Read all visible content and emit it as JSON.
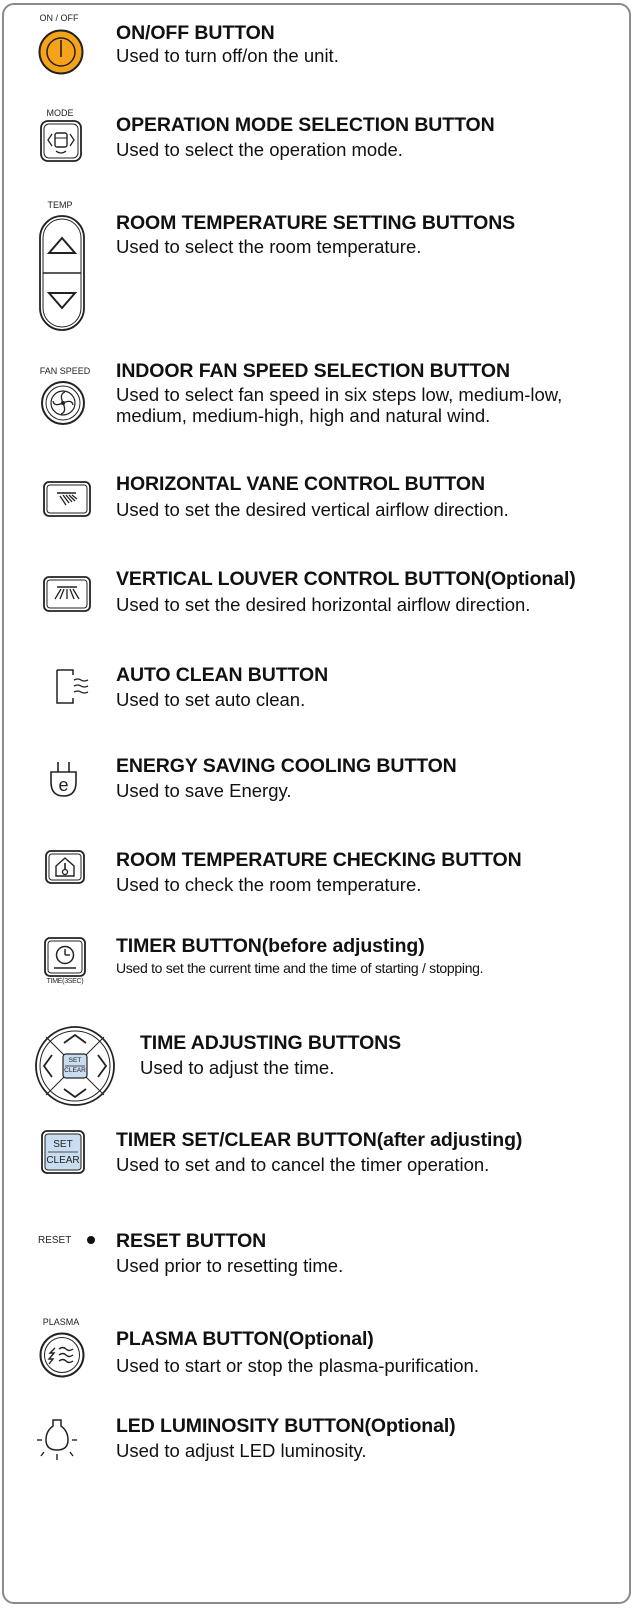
{
  "items": [
    {
      "label": "ON / OFF",
      "title": "ON/OFF BUTTON",
      "desc": "Used to turn off/on the unit.",
      "icon": "power-icon"
    },
    {
      "label": "MODE",
      "title": "OPERATION MODE SELECTION BUTTON",
      "desc": "Used to select the operation mode.",
      "icon": "mode-icon"
    },
    {
      "label": "TEMP",
      "title": "ROOM TEMPERATURE SETTING BUTTONS",
      "desc": "Used to select the room temperature.",
      "icon": "temp-up-down-icon"
    },
    {
      "label": "FAN SPEED",
      "title": "INDOOR FAN SPEED SELECTION BUTTON",
      "desc": "Used to select fan speed in six steps low, medium-low,",
      "desc2": "medium, medium-high, high and natural wind.",
      "icon": "fan-icon"
    },
    {
      "title": "HORIZONTAL VANE CONTROL BUTTON",
      "desc": "Used to set the desired vertical airflow direction.",
      "icon": "vane-icon"
    },
    {
      "title": "VERTICAL LOUVER CONTROL BUTTON(Optional)",
      "desc": "Used to set the desired horizontal airflow direction.",
      "icon": "louver-icon"
    },
    {
      "title": "AUTO CLEAN BUTTON",
      "desc": "Used to set auto clean.",
      "icon": "auto-clean-icon"
    },
    {
      "title": "ENERGY SAVING COOLING BUTTON",
      "desc": "Used to save Energy.",
      "icon": "energy-saving-icon"
    },
    {
      "title": "ROOM TEMPERATURE CHECKING BUTTON",
      "desc": "Used to check the room temperature.",
      "icon": "thermometer-house-icon"
    },
    {
      "label": "TIME(3SEC)",
      "title": "TIMER BUTTON(before adjusting)",
      "desc": "Used to set the current time and the time of starting / stopping.",
      "icon": "clock-icon"
    },
    {
      "title": "TIME ADJUSTING BUTTONS",
      "desc": "Used to adjust the time.",
      "icon": "direction-pad-icon",
      "pad_set": "SET",
      "pad_clear": "CLEAR"
    },
    {
      "title": "TIMER SET/CLEAR BUTTON(after adjusting)",
      "desc": "Used to set and to cancel the timer operation.",
      "icon": "set-clear-icon",
      "btn_set": "SET",
      "btn_clear": "CLEAR"
    },
    {
      "label": "RESET",
      "title": "RESET BUTTON",
      "desc": "Used prior to resetting time.",
      "icon": "reset-dot-icon"
    },
    {
      "label": "PLASMA",
      "title": "PLASMA BUTTON(Optional)",
      "desc": "Used to start or stop the plasma-purification.",
      "icon": "plasma-icon"
    },
    {
      "title": "LED LUMINOSITY BUTTON(Optional)",
      "desc": "Used to adjust LED luminosity.",
      "icon": "bulb-icon"
    }
  ],
  "colors": {
    "accent": "#f7a21b",
    "frame": "#8a8a8a",
    "set_clear_fill": "#c9dcf0"
  }
}
